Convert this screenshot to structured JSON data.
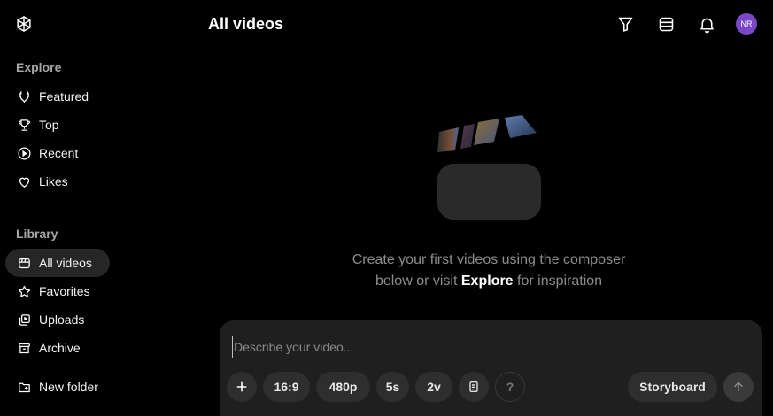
{
  "sidebar": {
    "explore_label": "Explore",
    "explore_items": [
      {
        "label": "Featured",
        "icon": "laurel-icon"
      },
      {
        "label": "Top",
        "icon": "trophy-icon"
      },
      {
        "label": "Recent",
        "icon": "play-circle-icon"
      },
      {
        "label": "Likes",
        "icon": "heart-icon"
      }
    ],
    "library_label": "Library",
    "library_items": [
      {
        "label": "All videos",
        "icon": "video-icon",
        "active": true
      },
      {
        "label": "Favorites",
        "icon": "star-icon"
      },
      {
        "label": "Uploads",
        "icon": "uploads-icon"
      },
      {
        "label": "Archive",
        "icon": "archive-icon"
      }
    ],
    "new_folder_label": "New folder"
  },
  "header": {
    "title": "All videos",
    "avatar_initials": "NR",
    "icons": [
      "filter-icon",
      "layout-icon",
      "bell-icon"
    ]
  },
  "empty_state": {
    "line1": "Create your first videos using the composer",
    "line2_prefix": "below or visit",
    "link": "Explore",
    "line2_suffix": "for inspiration"
  },
  "composer": {
    "placeholder": "Describe your video...",
    "value": "",
    "aspect": "16:9",
    "resolution": "480p",
    "duration": "5s",
    "variations": "2v",
    "help": "?",
    "storyboard": "Storyboard"
  },
  "colors": {
    "background": "#000000",
    "active_item": "#262626",
    "composer_bg": "#1f1f1f",
    "chip_bg": "#2e2e2e",
    "avatar": "#7b46c7"
  }
}
